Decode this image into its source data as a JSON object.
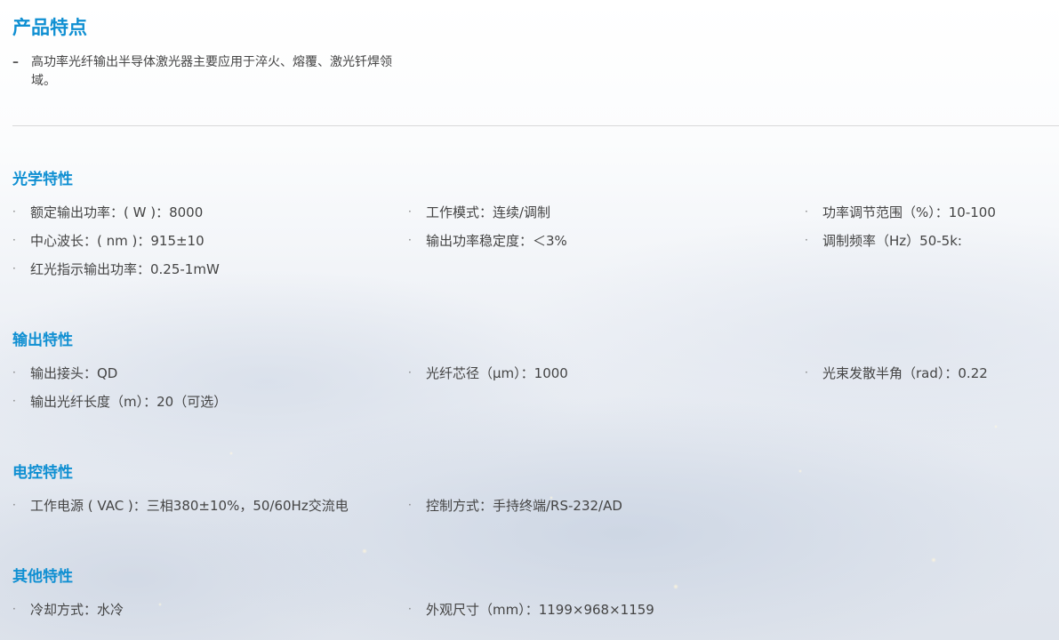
{
  "product_features": {
    "title": "产品特点",
    "description": "高功率光纤输出半导体激光器主要应用于淬火、熔覆、激光钎焊领域。"
  },
  "sections": [
    {
      "title": "光学特性",
      "items": [
        "额定输出功率：( W )：8000",
        "工作模式：连续/调制",
        "功率调节范围（%）：10-100",
        "中心波长：( nm )：915±10",
        "输出功率稳定度：＜3%",
        "调制频率（Hz）50-5k:",
        "红光指示输出功率：0.25-1mW"
      ]
    },
    {
      "title": "输出特性",
      "items": [
        "输出接头：QD",
        "光纤芯径（μm）：1000",
        "光束发散半角（rad）：0.22",
        "输出光纤长度（m）：20（可选）"
      ]
    },
    {
      "title": "电控特性",
      "items": [
        "工作电源 ( VAC )：三相380±10%，50/60Hz交流电",
        "控制方式：手持终端/RS-232/AD"
      ]
    },
    {
      "title": "其他特性",
      "items": [
        "冷却方式：水冷",
        "外观尺寸（mm）：1199×968×1159"
      ]
    }
  ],
  "bullet_glyph": "·",
  "intro_dash": "–",
  "colors": {
    "heading": "#0f8fd2",
    "text": "#444444",
    "divider": "#d9d9d9"
  }
}
